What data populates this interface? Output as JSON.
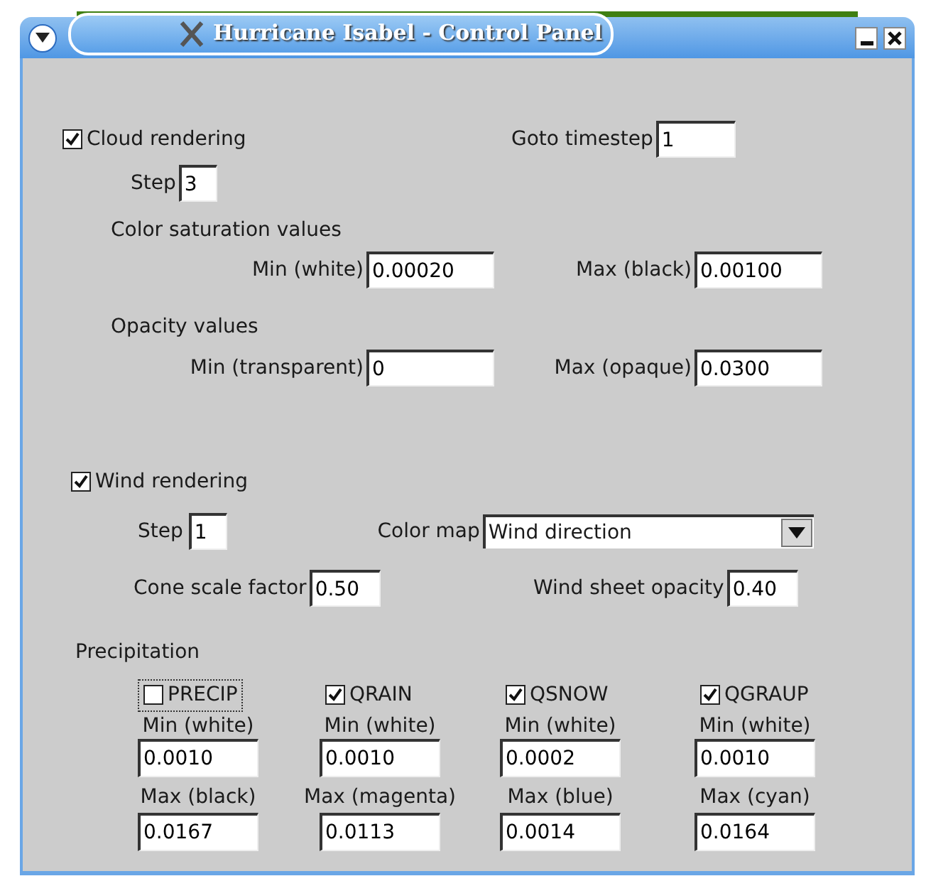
{
  "window": {
    "title": "Hurricane Isabel - Control Panel"
  },
  "cloud": {
    "label": "Cloud rendering",
    "checked": true,
    "goto_label": "Goto timestep",
    "goto_value": "1",
    "step_label": "Step",
    "step_value": "3",
    "saturation": {
      "heading": "Color saturation values",
      "min_label": "Min (white)",
      "min_value": "0.00020",
      "max_label": "Max (black)",
      "max_value": "0.00100"
    },
    "opacity": {
      "heading": "Opacity values",
      "min_label": "Min (transparent)",
      "min_value": "0",
      "max_label": "Max (opaque)",
      "max_value": "0.0300"
    }
  },
  "wind": {
    "label": "Wind rendering",
    "checked": true,
    "step_label": "Step",
    "step_value": "1",
    "color_map_label": "Color map",
    "color_map_value": "Wind direction",
    "cone_label": "Cone scale factor",
    "cone_value": "0.50",
    "sheet_label": "Wind sheet opacity",
    "sheet_value": "0.40"
  },
  "precipitation": {
    "heading": "Precipitation",
    "items": [
      {
        "label": "PRECIP",
        "checked": false,
        "focused": true,
        "min_label": "Min (white)",
        "min_value": "0.0010",
        "max_label": "Max (black)",
        "max_value": "0.0167"
      },
      {
        "label": "QRAIN",
        "checked": true,
        "focused": false,
        "min_label": "Min (white)",
        "min_value": "0.0010",
        "max_label": "Max (magenta)",
        "max_value": "0.0113"
      },
      {
        "label": "QSNOW",
        "checked": true,
        "focused": false,
        "min_label": "Min (white)",
        "min_value": "0.0002",
        "max_label": "Max (blue)",
        "max_value": "0.0014"
      },
      {
        "label": "QGRAUP",
        "checked": true,
        "focused": false,
        "min_label": "Min (white)",
        "min_value": "0.0010",
        "max_label": "Max (cyan)",
        "max_value": "0.0164"
      }
    ]
  }
}
